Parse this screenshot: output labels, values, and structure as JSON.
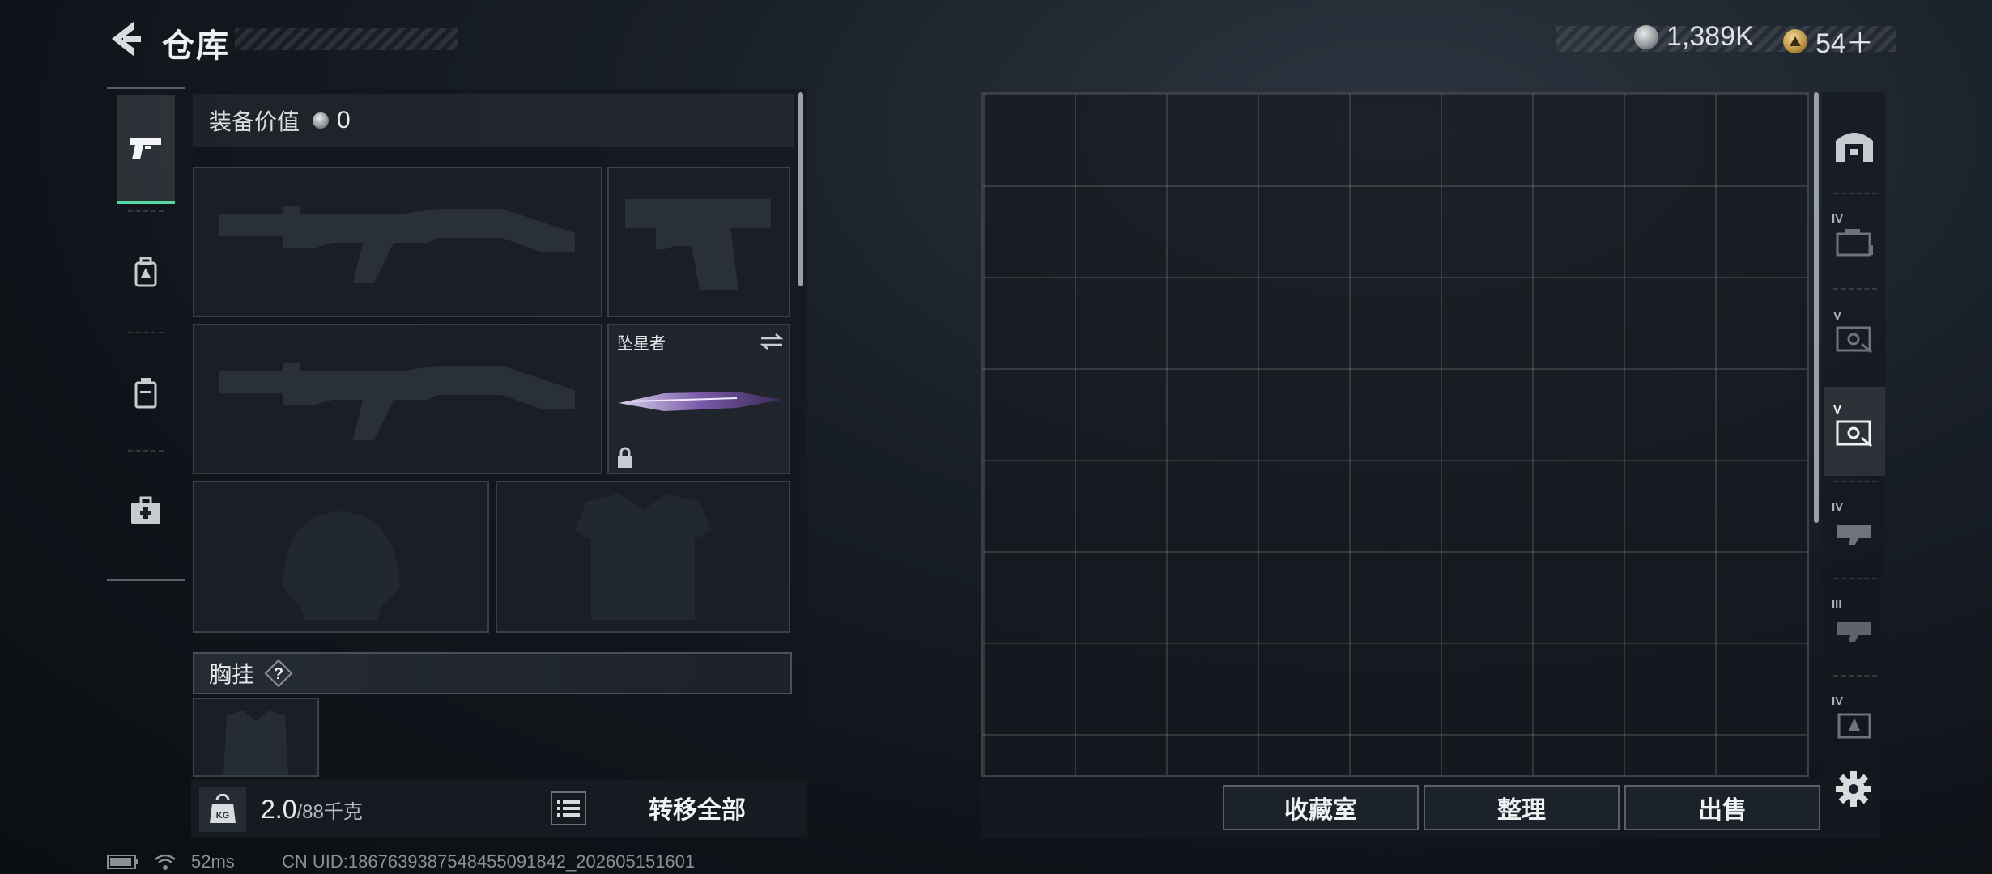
{
  "header": {
    "title": "仓库",
    "currency": {
      "coins": "1,389K",
      "gems": "54＋"
    }
  },
  "loadout": {
    "value_label": "装备价值",
    "value": "0",
    "slots": [
      {
        "name": "primary-weapon-1",
        "item": ""
      },
      {
        "name": "sidearm",
        "item": ""
      },
      {
        "name": "primary-weapon-2",
        "item": ""
      },
      {
        "name": "melee",
        "item": "坠星者",
        "locked": true
      },
      {
        "name": "helmet",
        "item": ""
      },
      {
        "name": "body-armor",
        "item": ""
      }
    ],
    "chest_rig": {
      "label": "胸挂",
      "help": "?"
    }
  },
  "bottom_left": {
    "weight_icon": "KG",
    "weight_value": "2.0",
    "weight_capacity": "/88千克",
    "transfer_all": "转移全部"
  },
  "stash": {
    "columns": 9,
    "rows": 7,
    "buttons": {
      "collection": "收藏室",
      "sort": "整理",
      "sell": "出售"
    }
  },
  "right_tabs": [
    {
      "name": "all",
      "tier": ""
    },
    {
      "name": "tier-4-case",
      "tier": "IV"
    },
    {
      "name": "tier-5-box",
      "tier": "V"
    },
    {
      "name": "tier-5-box-selected",
      "tier": "V"
    },
    {
      "name": "tier-4-rifle",
      "tier": "IV"
    },
    {
      "name": "tier-3-rifle",
      "tier": "III"
    },
    {
      "name": "tier-4-gear",
      "tier": "IV"
    }
  ],
  "footer": {
    "ping": "52ms",
    "uid": "CN UID:1867639387548455091842_202605151601"
  },
  "colors": {
    "accent": "#54d9a0",
    "panel": "#1a1f27"
  }
}
